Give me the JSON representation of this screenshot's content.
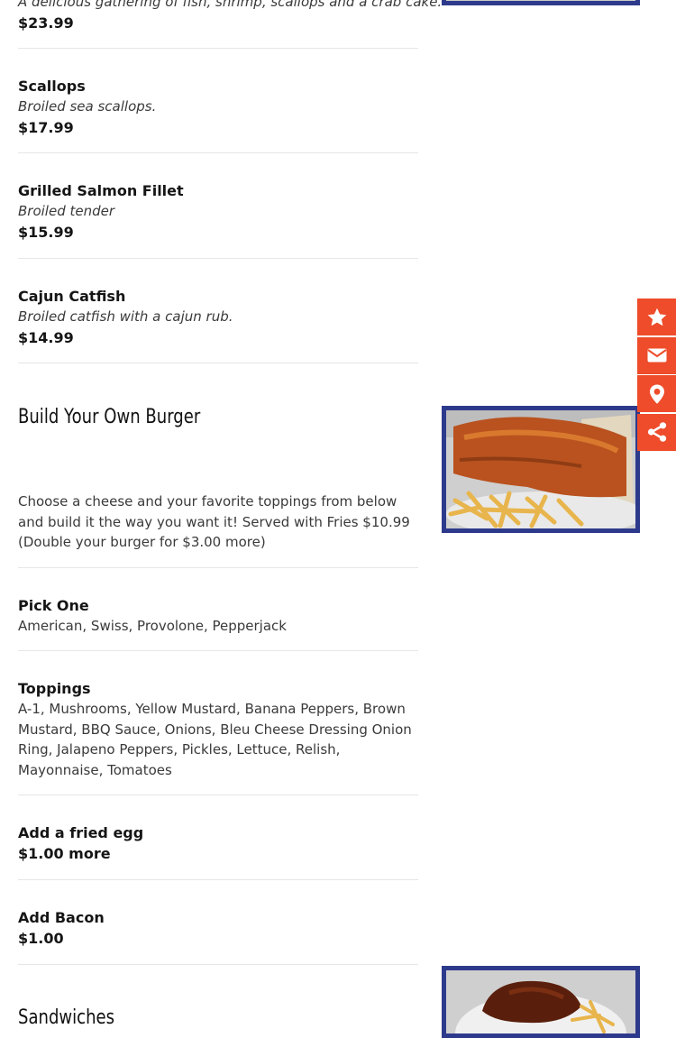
{
  "items_top": [
    {
      "name": "",
      "description": "A delicious gathering of fish, shrimp, scallops and a crab cake.",
      "price": "$23.99"
    },
    {
      "name": "Scallops",
      "description": "Broiled sea scallops.",
      "price": "$17.99"
    },
    {
      "name": "Grilled Salmon Fillet",
      "description": "Broiled tender",
      "price": "$15.99"
    },
    {
      "name": "Cajun Catfish",
      "description": "Broiled catfish with a cajun rub.",
      "price": "$14.99"
    }
  ],
  "burger_section": {
    "title": "Build Your Own Burger",
    "description": "Choose a cheese and your favorite toppings from below and build it the way you want it! Served with Fries  $10.99 (Double your burger for $3.00 more)",
    "options": [
      {
        "name": "Pick One",
        "text": "American, Swiss, Provolone, Pepperjack"
      },
      {
        "name": "Toppings",
        "text": "A-1, Mushrooms, Yellow Mustard, Banana Peppers, Brown Mustard, BBQ Sauce, Onions, Bleu Cheese Dressing Onion Ring, Jalapeno Peppers, Pickles, Lettuce, Relish, Mayonnaise, Tomatoes"
      },
      {
        "name": "Add a fried egg",
        "price": "$1.00 more"
      },
      {
        "name": "Add Bacon",
        "price": "$1.00"
      }
    ]
  },
  "next_section": {
    "title": "Sandwiches"
  },
  "social_bar": {
    "accent": "#ee4c2a",
    "icons": [
      "star-icon",
      "envelope-icon",
      "map-pin-icon",
      "share-icon"
    ]
  },
  "photo_border": "#2d3a8c"
}
